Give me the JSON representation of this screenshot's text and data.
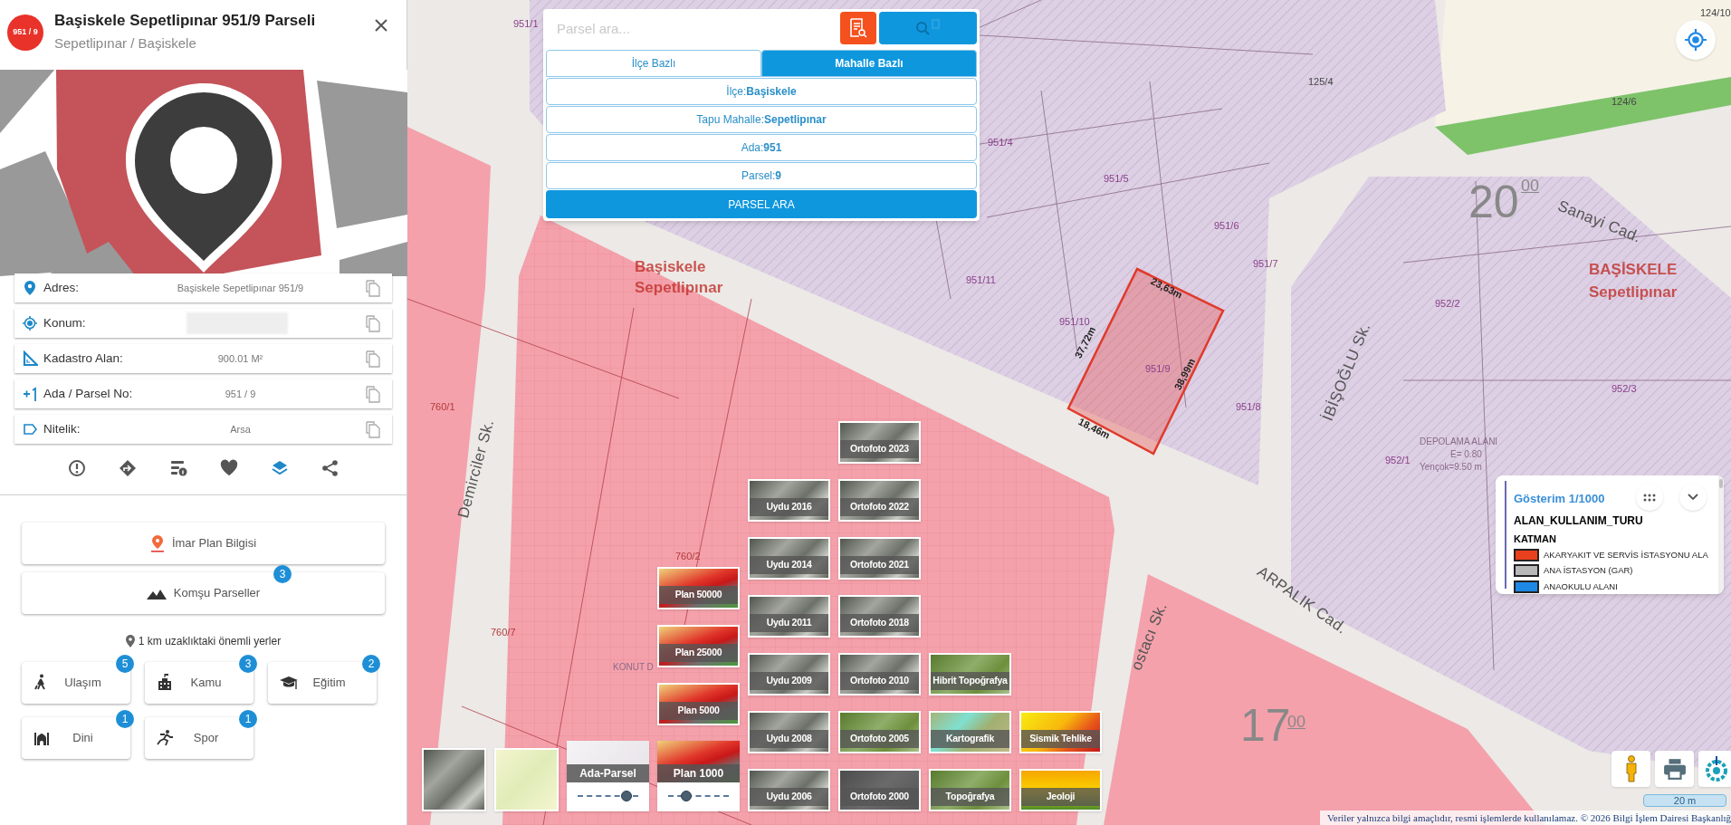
{
  "parcel_panel": {
    "badge": "951 / 9",
    "title": "Başiskele Sepetlipınar 951/9 Parseli",
    "subtitle": "Sepetlipınar / Başiskele",
    "info_rows": [
      {
        "label": "Adres:",
        "kind": "text",
        "value": "Başiskele Sepetlipınar 951/9"
      },
      {
        "label": "Konum:",
        "kind": "redacted"
      },
      {
        "label": "Kadastro Alan:",
        "kind": "text",
        "value": "900.01 M²"
      },
      {
        "label": "Ada / Parsel No:",
        "kind": "text",
        "value": "951 / 9"
      },
      {
        "label": "Nitelik:",
        "kind": "text",
        "value": "Arsa"
      }
    ],
    "actions": [
      {
        "selected": false
      },
      {
        "selected": false
      },
      {
        "selected": false
      },
      {
        "selected": false
      },
      {
        "selected": true
      },
      {
        "selected": false
      }
    ],
    "wide_buttons": [
      {
        "label": "İmar Plan Bilgisi"
      },
      {
        "label": "Komşu Parseller",
        "badge": "3"
      }
    ],
    "nearby_title": "1 km uzaklıktaki önemli yerler",
    "nearby": [
      {
        "label": "Ulaşım",
        "badge": "5"
      },
      {
        "label": "Kamu",
        "badge": "3"
      },
      {
        "label": "Eğitim",
        "badge": "2"
      },
      {
        "label": "Dini",
        "badge": "1"
      },
      {
        "label": "Spor",
        "badge": "1"
      }
    ]
  },
  "search": {
    "placeholder": "Parsel ara...",
    "tabs": [
      {
        "label": "İlçe Bazlı",
        "selected": false
      },
      {
        "label": "Mahalle Bazlı",
        "selected": true
      }
    ],
    "fields": [
      "İlçe:**Başiskele**",
      "Tapu Mahalle:**Sepetlipınar**",
      "Ada:**951**",
      "Parsel:**9**"
    ],
    "submit": "PARSEL ARA"
  },
  "map_labels": [
    {
      "text": "951/1",
      "kind": "parcel"
    },
    {
      "text": "951/4",
      "kind": "parcel"
    },
    {
      "text": "951/5",
      "kind": "parcel"
    },
    {
      "text": "951/6",
      "kind": "parcel"
    },
    {
      "text": "951/7",
      "kind": "parcel"
    },
    {
      "text": "951/11",
      "kind": "parcel"
    },
    {
      "text": "951/10",
      "kind": "parcel"
    },
    {
      "text": "951/9",
      "kind": "parcel"
    },
    {
      "text": "951/8",
      "kind": "parcel"
    },
    {
      "text": "952/2",
      "kind": "parcel"
    },
    {
      "text": "952/3",
      "kind": "parcel"
    },
    {
      "text": "952/1",
      "kind": "parcel"
    },
    {
      "text": "125/4",
      "kind": "plain"
    },
    {
      "text": "124/6",
      "kind": "plain"
    },
    {
      "text": "124/10",
      "kind": "plain"
    },
    {
      "text": "760/1",
      "kind": "zone"
    },
    {
      "text": "760/2",
      "kind": "zone"
    },
    {
      "text": "760/7",
      "kind": "zone"
    },
    {
      "text": "Başiskele",
      "kind": "district"
    },
    {
      "text": "Sepetlipınar",
      "kind": "district"
    },
    {
      "text": "BAŞİSKELE",
      "kind": "district"
    },
    {
      "text": "Sepetlipınar",
      "kind": "district"
    },
    {
      "text": "Sanayi Cad.",
      "kind": "street"
    },
    {
      "text": "ARPALIK Cad.",
      "kind": "street"
    },
    {
      "text": "İBİŞOĞLU Sk.",
      "kind": "street"
    },
    {
      "text": "Demirciler Sk.",
      "kind": "street"
    },
    {
      "text": "ostacı Sk.",
      "kind": "street"
    },
    {
      "text": "23,63m",
      "kind": "measure"
    },
    {
      "text": "37,72m",
      "kind": "measure"
    },
    {
      "text": "38,99m",
      "kind": "measure"
    },
    {
      "text": "18,46m",
      "kind": "measure"
    },
    {
      "text": "20",
      "kind": "grid"
    },
    {
      "text": "00",
      "kind": "grid_small"
    },
    {
      "text": "17",
      "kind": "grid"
    },
    {
      "text": "00",
      "kind": "grid_small"
    },
    {
      "text": "DEPOLAMA ALANI",
      "kind": "note"
    },
    {
      "text": "E= 0.80",
      "kind": "note"
    },
    {
      "text": "Yençok=9.50 m",
      "kind": "note"
    },
    {
      "text": "KONUT D",
      "kind": "note"
    }
  ],
  "layer_columns": [
    [
      {
        "kind": "satellite"
      }
    ],
    [
      {
        "kind": "streetmap"
      }
    ],
    [
      {
        "label": "Ada-Parsel",
        "kind": "parcel",
        "level": 0.8
      }
    ],
    [
      {
        "label": "Plan 50000",
        "kind": "plan"
      },
      {
        "label": "Plan 25000",
        "kind": "plan"
      },
      {
        "label": "Plan 5000",
        "kind": "plan"
      },
      {
        "label": "Plan 1000",
        "kind": "plan",
        "level": 0.3
      }
    ],
    [
      {
        "label": "Uydu 2016",
        "kind": "satellite"
      },
      {
        "label": "Uydu 2014",
        "kind": "satellite"
      },
      {
        "label": "Uydu 2011",
        "kind": "satellite"
      },
      {
        "label": "Uydu 2009",
        "kind": "satellite"
      },
      {
        "label": "Uydu 2008",
        "kind": "satellite"
      },
      {
        "label": "Uydu 2006",
        "kind": "satellite"
      }
    ],
    [
      {
        "label": "Ortofoto 2023",
        "kind": "satellite"
      },
      {
        "label": "Ortofoto 2022",
        "kind": "satellite"
      },
      {
        "label": "Ortofoto 2021",
        "kind": "satellite"
      },
      {
        "label": "Ortofoto 2018",
        "kind": "satellite"
      },
      {
        "label": "Ortofoto 2010",
        "kind": "satellite"
      },
      {
        "label": "Ortofoto 2005",
        "kind": "topo"
      },
      {
        "label": "Ortofoto 2000",
        "kind": "dark"
      }
    ],
    [
      {
        "label": "Hibrit Topoğrafya",
        "kind": "topo"
      },
      {
        "label": "Kartografik",
        "kind": "cartographic"
      },
      {
        "label": "Topoğrafya",
        "kind": "topo"
      }
    ],
    [
      {
        "label": "Sismik Tehlike",
        "kind": "hazard"
      },
      {
        "label": "Jeoloji",
        "kind": "geology"
      }
    ]
  ],
  "legend": {
    "title": "Gösterim 1/1000",
    "layer": "ALAN_KULLANIM_TURU",
    "group": "KATMAN",
    "entries": [
      {
        "label": "AKARYAKIT VE SERVİS İSTASYONU ALA",
        "color": "#e8401c"
      },
      {
        "label": "ANA İSTASYON (GAR)",
        "color": "#b8b8b8"
      },
      {
        "label": "ANAOKULU ALANI",
        "color": "#1e88e5"
      }
    ]
  },
  "scale_bar": "20 m",
  "attribution": "Veriler yalnızca bilgi amaçlıdır, resmi işlemlerde kullanılamaz. © 2026 Bilgi İşlem Dairesi Başkanlığ"
}
